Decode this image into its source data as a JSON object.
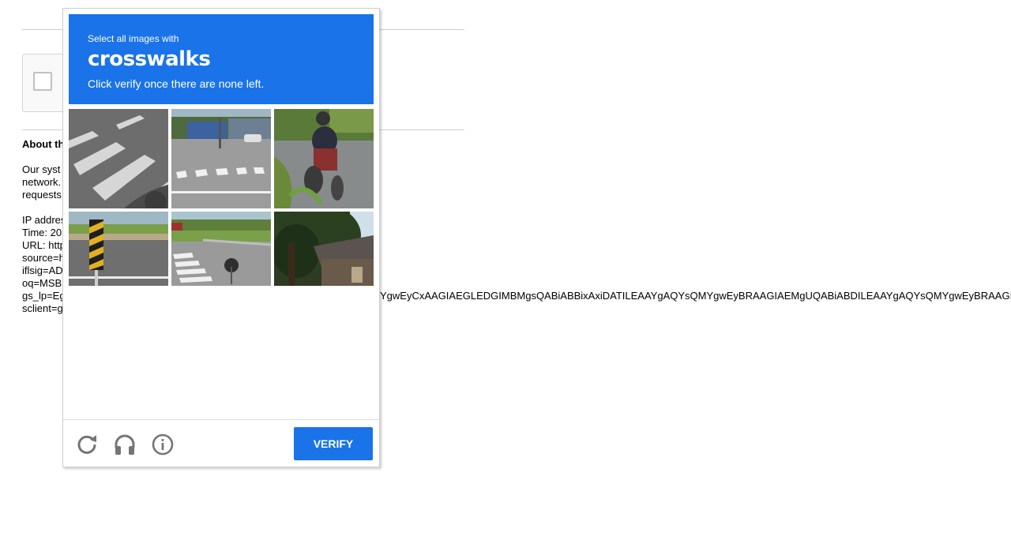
{
  "background_page": {
    "about_heading": "About th",
    "paragraph_lines": [
      "Our syst",
      "network.",
      "requests"
    ],
    "info_lines": [
      "IP addres",
      "Time: 20",
      "URL: http",
      "source=h",
      "iflsig=AD",
      "oq=MSB",
      "gs_lp=Eg",
      "sclient=g"
    ],
    "overflow_text": "YgwEyCxAAGIAEGLEDGIMBMgsQABiABBixAxiDATILEAAYgAQYsQMYgwEyBRAAGIAEMgUQABiABDILEAAYgAQYsQMYgwEyBRAAGIAE"
  },
  "captcha": {
    "instruction": "Select all images with",
    "keyword": "crosswalks",
    "subinstruction": "Click verify once there are none left.",
    "tiles": [
      {
        "scene": "crosswalk-closeup"
      },
      {
        "scene": "intersection-with-tram"
      },
      {
        "scene": "motorcycle-rider"
      },
      {
        "scene": "road-marker-post"
      },
      {
        "scene": "crosswalk-corner"
      },
      {
        "scene": "tree-and-house"
      }
    ],
    "footer": {
      "reload_icon": "reload-icon",
      "audio_icon": "headphones-icon",
      "info_icon": "info-icon",
      "verify_label": "VERIFY"
    },
    "colors": {
      "accent": "#1a73e8",
      "icon_gray": "#757575"
    }
  }
}
